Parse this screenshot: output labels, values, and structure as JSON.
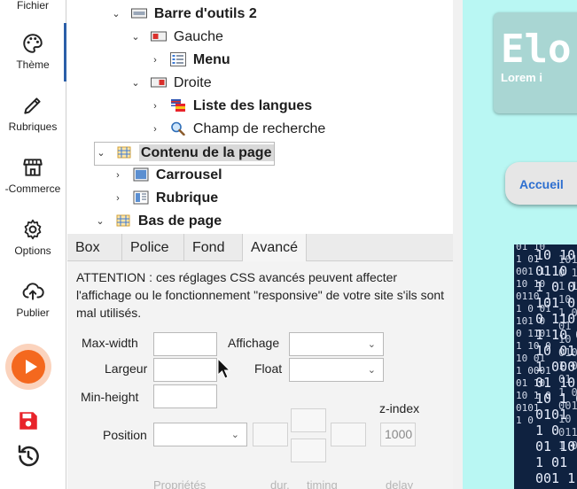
{
  "colors": {
    "accent_blue": "#2b5fa8",
    "play_orange": "#f4681e",
    "play_ring": "#fbd3bd",
    "save_red": "#e8232a",
    "preview_bg": "#b9f7f3",
    "preview_header": "#a9d6d3",
    "link_blue": "#2d6fd0"
  },
  "rail": {
    "items": [
      {
        "label": "Fichier",
        "icon": "file-icon"
      },
      {
        "label": "Thème",
        "icon": "palette-icon"
      },
      {
        "label": "Rubriques",
        "icon": "pencil-icon"
      },
      {
        "label": "-Commerce",
        "icon": "store-icon"
      },
      {
        "label": "Options",
        "icon": "gear-icon"
      },
      {
        "label": "Publier",
        "icon": "cloud-upload-icon"
      }
    ],
    "actions": [
      {
        "name": "play",
        "icon": "play-icon"
      },
      {
        "name": "save",
        "icon": "save-icon"
      },
      {
        "name": "history",
        "icon": "history-icon"
      }
    ]
  },
  "tree": {
    "nodes": [
      {
        "label": "Barre d'outils 2",
        "icon": "toolbar-icon",
        "expanded": true,
        "bold": true
      },
      {
        "label": "Gauche",
        "icon": "align-left-icon",
        "expanded": true,
        "bold": false
      },
      {
        "label": "Menu",
        "icon": "menu-icon",
        "expanded": false,
        "bold": true
      },
      {
        "label": "Droite",
        "icon": "align-right-icon",
        "expanded": true,
        "bold": false
      },
      {
        "label": "Liste des langues",
        "icon": "flags-icon",
        "expanded": false,
        "bold": true
      },
      {
        "label": "Champ de recherche",
        "icon": "magnifier-icon",
        "expanded": false,
        "bold": false
      },
      {
        "label": "Contenu de la page",
        "icon": "layout-icon",
        "expanded": true,
        "bold": true,
        "selected": true
      },
      {
        "label": "Carrousel",
        "icon": "carousel-icon",
        "expanded": false,
        "bold": true
      },
      {
        "label": "Rubrique",
        "icon": "section-icon",
        "expanded": false,
        "bold": true
      },
      {
        "label": "Bas de page",
        "icon": "layout-icon",
        "expanded": true,
        "bold": true
      }
    ]
  },
  "tabs": [
    {
      "label": "Box",
      "active": false
    },
    {
      "label": "Police",
      "active": false
    },
    {
      "label": "Fond",
      "active": false
    },
    {
      "label": "Avancé",
      "active": true
    }
  ],
  "settings": {
    "warning": "ATTENTION : ces réglages CSS avancés peuvent affecter l'affichage ou le fonctionnement \"responsive\" de votre site s'ils sont mal utilisés.",
    "labels": {
      "max_width": "Max-width",
      "largeur": "Largeur",
      "min_height": "Min-height",
      "affichage": "Affichage",
      "float": "Float",
      "position": "Position",
      "z_index": "z-index"
    },
    "values": {
      "max_width": "",
      "largeur": "",
      "min_height": "",
      "affichage": "",
      "float": "",
      "position": "",
      "z_index": "1000"
    },
    "faded_headers": [
      "Propriétés",
      "dur.",
      "timing",
      "delay"
    ]
  },
  "preview": {
    "title": "Elo",
    "subtitle": "Lorem i",
    "nav_link": "Accueil",
    "binary_lines": [
      "01 10",
      "1 01",
      "001 1",
      "10 10",
      "0110 1",
      "1 0 01",
      "101 0",
      "0 1101",
      "1 10 0",
      "10 01",
      "1 0001",
      "01 10",
      "10 1 0",
      "0101",
      "1 0"
    ]
  }
}
